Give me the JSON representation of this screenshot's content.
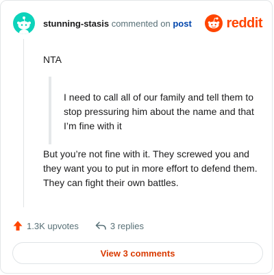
{
  "comment": {
    "username": "stunning-stasis",
    "action_text": "commented on",
    "post_link": "post",
    "brand": "reddit",
    "body_first": "NTA",
    "quote": "I need to call all of our family and tell them to stop pressuring him about the name and that I’m fine with it",
    "body_second": "But you’re not fine with it. They screwed you and they want you to put in more effort to defend them. They can fight their own battles."
  },
  "actions": {
    "upvotes": "1.3K upvotes",
    "replies": "3 replies"
  },
  "view_comments_label": "View 3 comments",
  "colors": {
    "brand": "#ff4500",
    "avatar": "#0dd3bb",
    "link": "#0045ac",
    "button_text": "#d93a00"
  },
  "icons": {
    "avatar": "snoo-avatar",
    "logo": "reddit-logo",
    "upvote": "upvote-arrow-icon",
    "reply": "reply-arrow-icon"
  }
}
